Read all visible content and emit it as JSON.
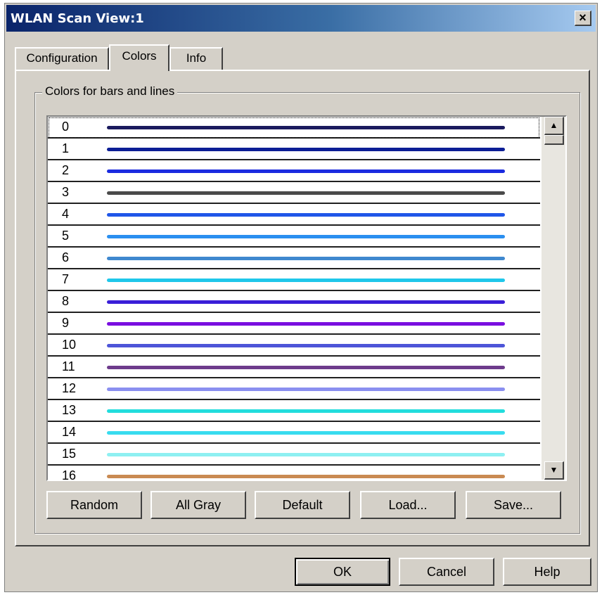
{
  "window": {
    "title": "WLAN Scan View:1",
    "close_glyph": "×"
  },
  "tabs": [
    {
      "label": "Configuration",
      "active": false
    },
    {
      "label": "Colors",
      "active": true
    },
    {
      "label": "Info",
      "active": false
    }
  ],
  "group": {
    "label": "Colors for bars and lines"
  },
  "colors": [
    {
      "index": "0",
      "color": "#1a1a5e"
    },
    {
      "index": "1",
      "color": "#0c1e96"
    },
    {
      "index": "2",
      "color": "#1a2be0"
    },
    {
      "index": "3",
      "color": "#4a4a4a"
    },
    {
      "index": "4",
      "color": "#1f56e8"
    },
    {
      "index": "5",
      "color": "#2a8ff0"
    },
    {
      "index": "6",
      "color": "#3f88cf"
    },
    {
      "index": "7",
      "color": "#1fc7ea"
    },
    {
      "index": "8",
      "color": "#3a1ed8"
    },
    {
      "index": "9",
      "color": "#7a0ee0"
    },
    {
      "index": "10",
      "color": "#4d55d8"
    },
    {
      "index": "11",
      "color": "#6e3b8c"
    },
    {
      "index": "12",
      "color": "#8a8ff0"
    },
    {
      "index": "13",
      "color": "#22dddd"
    },
    {
      "index": "14",
      "color": "#38dcef"
    },
    {
      "index": "15",
      "color": "#8ef0f2"
    },
    {
      "index": "16",
      "color": "#c98a52"
    }
  ],
  "scrollbar": {
    "up_glyph": "▲",
    "down_glyph": "▼"
  },
  "panel_buttons": {
    "random": "Random",
    "all_gray": "All Gray",
    "default": "Default",
    "load": "Load...",
    "save": "Save..."
  },
  "dialog_buttons": {
    "ok": "OK",
    "cancel": "Cancel",
    "help": "Help"
  }
}
